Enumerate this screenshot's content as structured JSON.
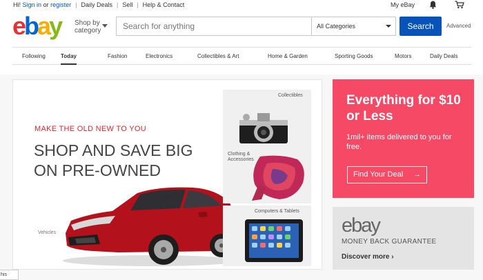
{
  "topbar": {
    "greeting": "Hi!",
    "signin": "Sign in",
    "or": "or",
    "register": "register",
    "links": [
      "Daily Deals",
      "Sell",
      "Help & Contact"
    ],
    "my_ebay": "My eBay"
  },
  "header": {
    "logo": {
      "e": "e",
      "b": "b",
      "a": "a",
      "y": "y"
    },
    "shop_by_category": "Shop by category",
    "search_placeholder": "Search for anything",
    "category_selected": "All Categories",
    "search_button": "Search",
    "advanced": "Advanced"
  },
  "nav": {
    "items": [
      "Following",
      "Today",
      "Fashion",
      "Electronics",
      "Collectibles & Art",
      "Home & Garden",
      "Sporting Goods",
      "Motors",
      "Daily Deals"
    ],
    "active": "Today"
  },
  "hero": {
    "tagline": "MAKE THE OLD NEW TO YOU",
    "title": "SHOP AND SAVE BIG ON PRE-OWNED",
    "vehicles_label": "Vehicles",
    "tiles": [
      {
        "label": "Collectibles"
      },
      {
        "label": "Clothing & Accessories"
      },
      {
        "label": "Computers & Tablets"
      }
    ]
  },
  "promo": {
    "title": "Everything for $10 or Less",
    "subtitle": "1mil+ items delivered to you for free.",
    "button": "Find Your Deal",
    "button_arrow": "→"
  },
  "guarantee": {
    "logo": "ebay",
    "text": "MONEY BACK GUARANTEE",
    "link": "Discover more",
    "link_arrow": "›"
  },
  "bottom_tab": "his",
  "colors": {
    "brand_blue": "#0654ba",
    "promo_pink": "#f64966",
    "tagline_red": "#d9272e",
    "car_red": "#b3121c"
  }
}
